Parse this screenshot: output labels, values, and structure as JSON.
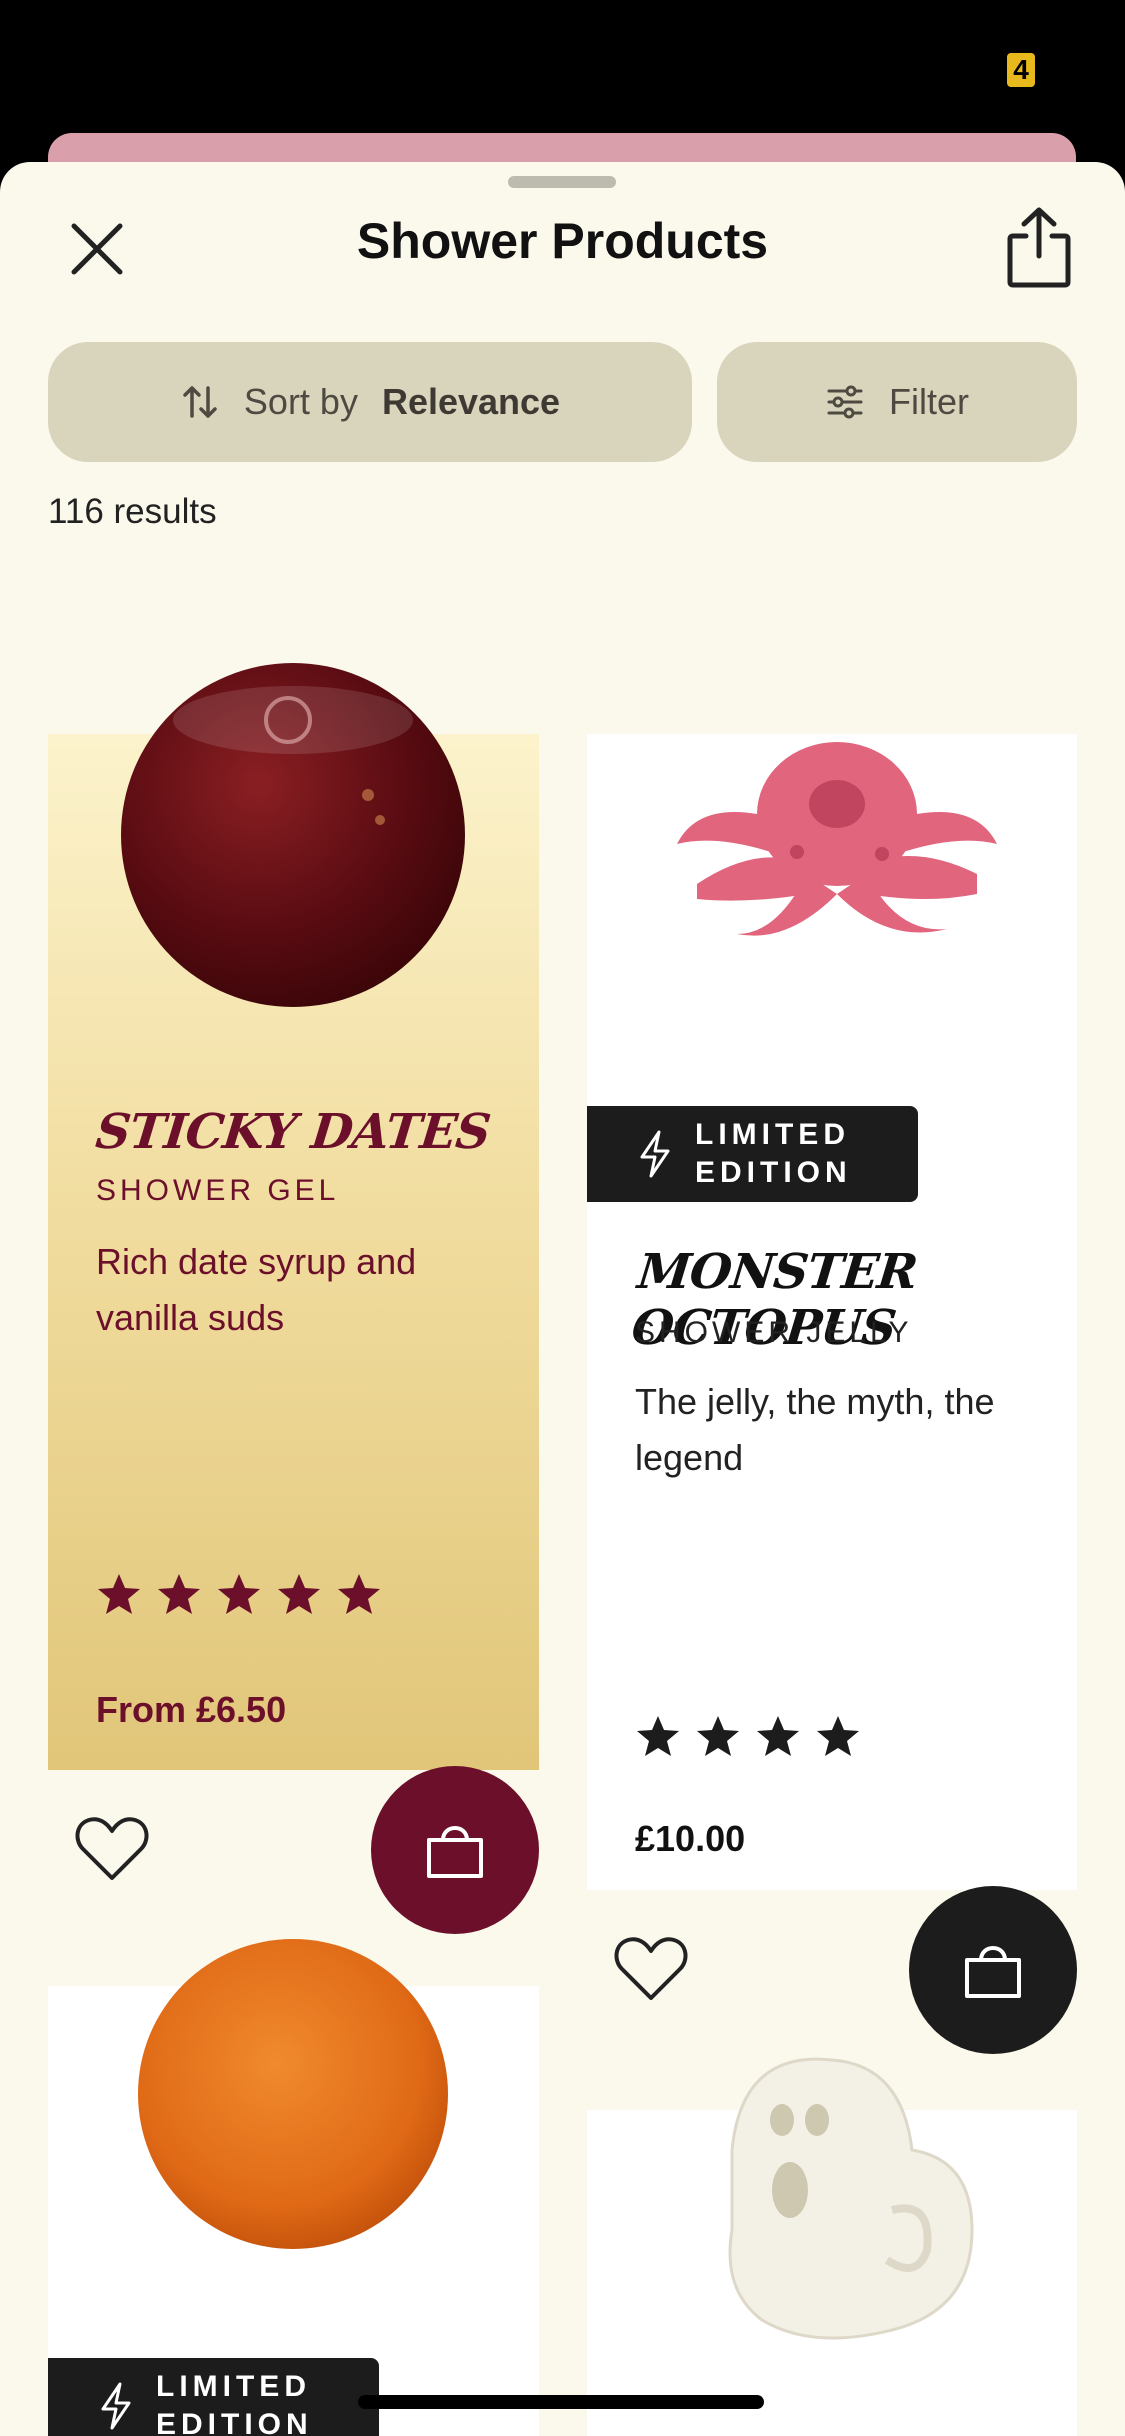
{
  "status_bar": {
    "badge": "4"
  },
  "header": {
    "title": "Shower Products"
  },
  "toolbar": {
    "sort_label": "Sort by",
    "sort_value": "Relevance",
    "filter_label": "Filter"
  },
  "results_count": "116 results",
  "colors": {
    "sheet_bg": "#fbf8ec",
    "pill_bg": "#d9d5bd",
    "burgundy": "#6b0f2b",
    "dark": "#1c1c1c"
  },
  "products": [
    {
      "name": "STICKY DATES",
      "type": "SHOWER GEL",
      "description": "Rich date syrup and vanilla suds",
      "rating": 5,
      "price": "From £6.50",
      "badge": "",
      "image_icon": "date-syrup-gel-blob"
    },
    {
      "name": "MONSTER OCTOPUS",
      "type": "SHOWER JELLY",
      "description": "The jelly, the myth, the legend",
      "rating": 4,
      "price": "£10.00",
      "badge": "LIMITED EDITION",
      "image_icon": "pink-octopus-jelly"
    },
    {
      "badge": "LIMITED EDITION",
      "image_icon": "orange-gel-blob"
    },
    {
      "image_icon": "ghost-soap"
    }
  ]
}
